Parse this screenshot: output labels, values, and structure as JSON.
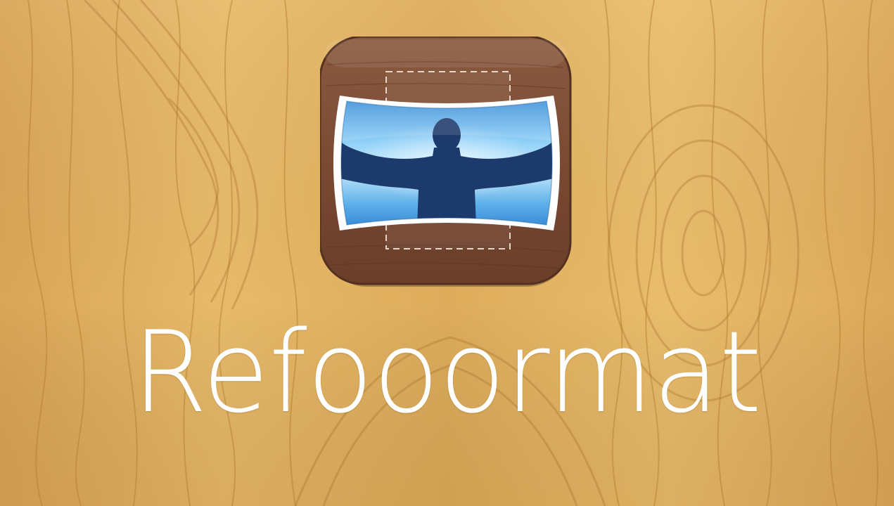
{
  "app": {
    "name": "Refooormat",
    "icon_name": "refooormat-app-icon"
  },
  "colors": {
    "wood_light": "#e6b865",
    "wood_mid": "#d7a34f",
    "wood_dark": "#b98432",
    "icon_wood": "#7a4a34",
    "icon_sky_top": "#b9e3fb",
    "icon_sky_mid": "#4aa5e6",
    "icon_silhouette": "#1d3a6c",
    "text": "#ffffff"
  }
}
